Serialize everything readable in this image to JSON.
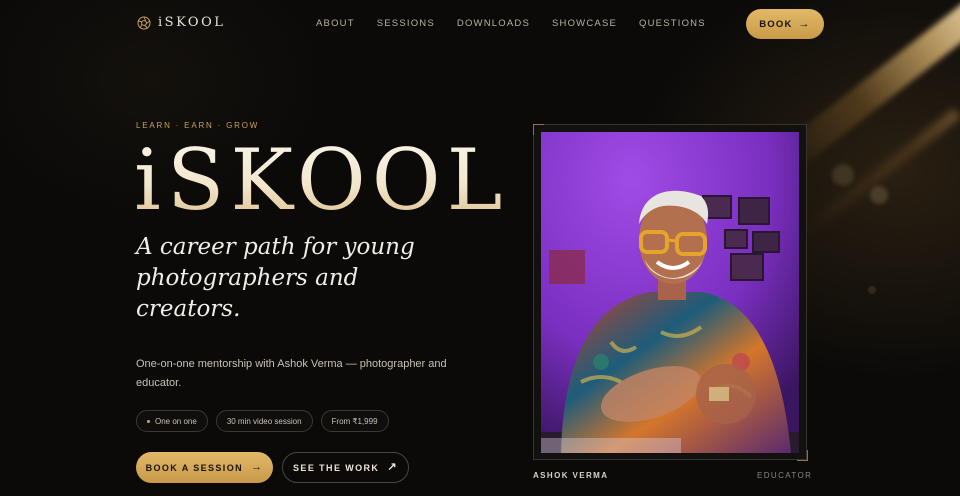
{
  "brand": {
    "name": "iSKOOL",
    "logo_icon": "aperture-icon",
    "accent": "#d4a656"
  },
  "nav": {
    "items": [
      {
        "label": "ABOUT"
      },
      {
        "label": "SESSIONS"
      },
      {
        "label": "DOWNLOADS"
      },
      {
        "label": "SHOWCASE"
      },
      {
        "label": "QUESTIONS"
      }
    ],
    "book_label": "BOOK",
    "book_icon": "arrow-right-icon"
  },
  "hero": {
    "eyebrow": "LEARN · EARN · GROW",
    "title": "iSKOOL",
    "tagline": "A career path for young photographers and creators.",
    "description": "One-on-one mentorship with Ashok Verma — photographer and educator.",
    "chips": [
      {
        "label": "One on one"
      },
      {
        "label": "30 min video session"
      },
      {
        "label": "From ₹1,999"
      }
    ],
    "primary_cta": {
      "label": "BOOK A SESSION",
      "icon": "arrow-right-icon"
    },
    "secondary_cta": {
      "label": "SEE THE WORK",
      "icon": "arrow-up-right-icon"
    }
  },
  "portrait": {
    "name": "ASHOK VERMA",
    "role": "EDUCATOR"
  }
}
